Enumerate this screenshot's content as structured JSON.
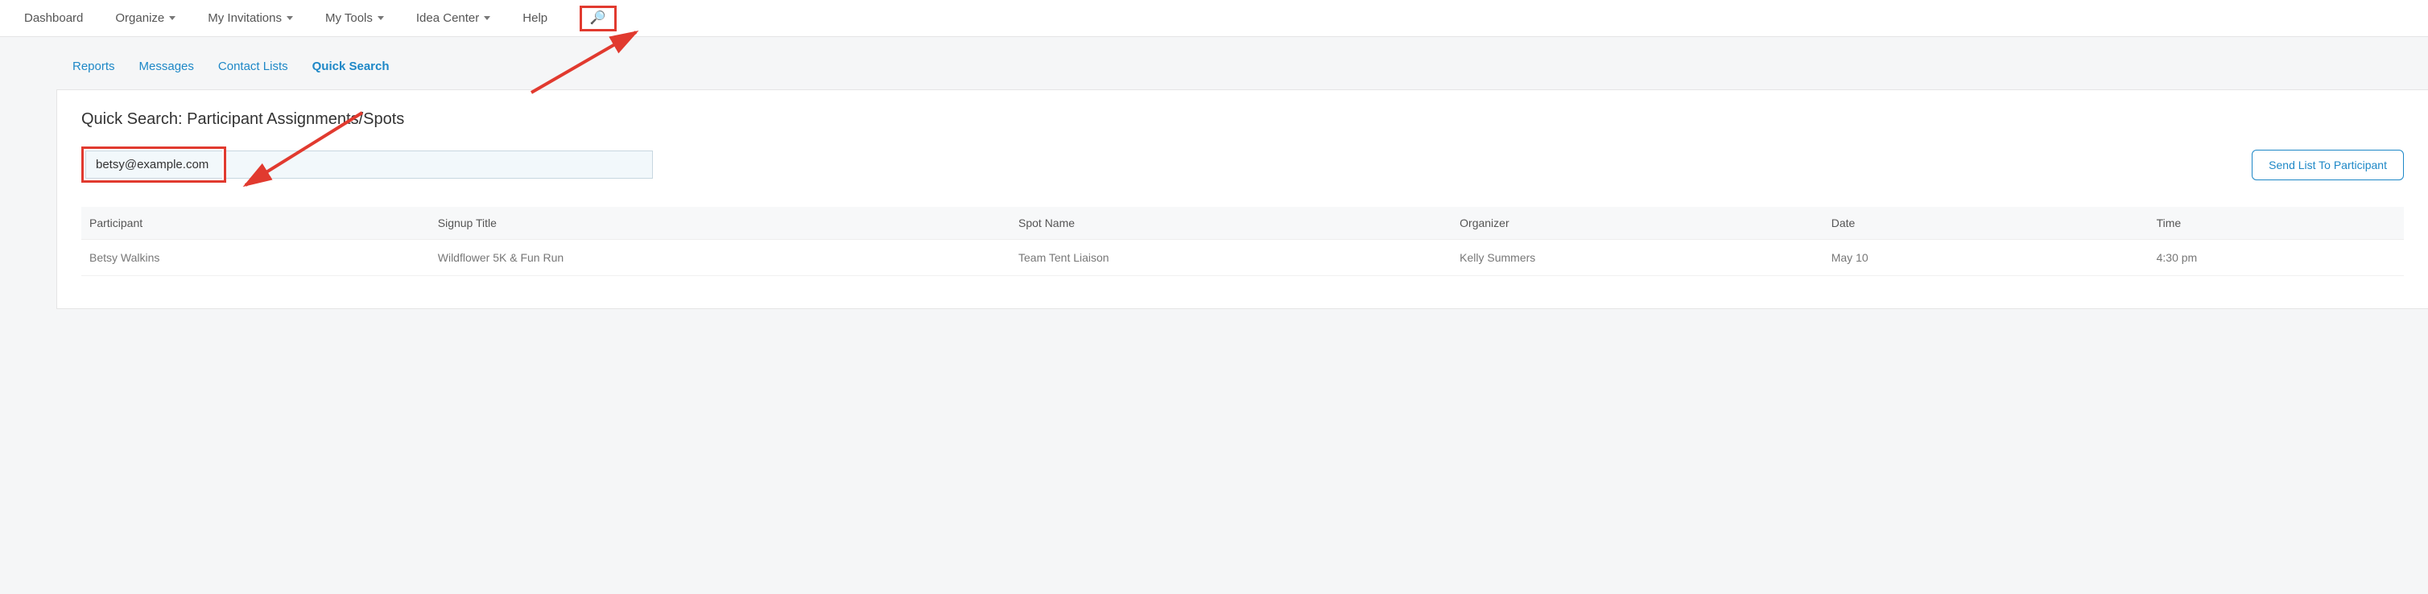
{
  "topnav": {
    "dashboard": "Dashboard",
    "organize": "Organize",
    "invitations": "My Invitations",
    "tools": "My Tools",
    "ideas": "Idea Center",
    "help": "Help"
  },
  "subnav": {
    "reports": "Reports",
    "messages": "Messages",
    "contacts": "Contact Lists",
    "quicksearch": "Quick Search"
  },
  "page": {
    "title": "Quick Search: Participant Assignments/Spots",
    "search_value": "betsy@example.com",
    "send_button": "Send List To Participant"
  },
  "table": {
    "headers": {
      "participant": "Participant",
      "title": "Signup Title",
      "spot": "Spot Name",
      "organizer": "Organizer",
      "date": "Date",
      "time": "Time"
    },
    "rows": [
      {
        "participant": "Betsy Walkins",
        "title": "Wildflower 5K & Fun Run",
        "spot": "Team Tent Liaison",
        "organizer": "Kelly Summers",
        "date": "May 10",
        "time": "4:30 pm"
      }
    ]
  }
}
